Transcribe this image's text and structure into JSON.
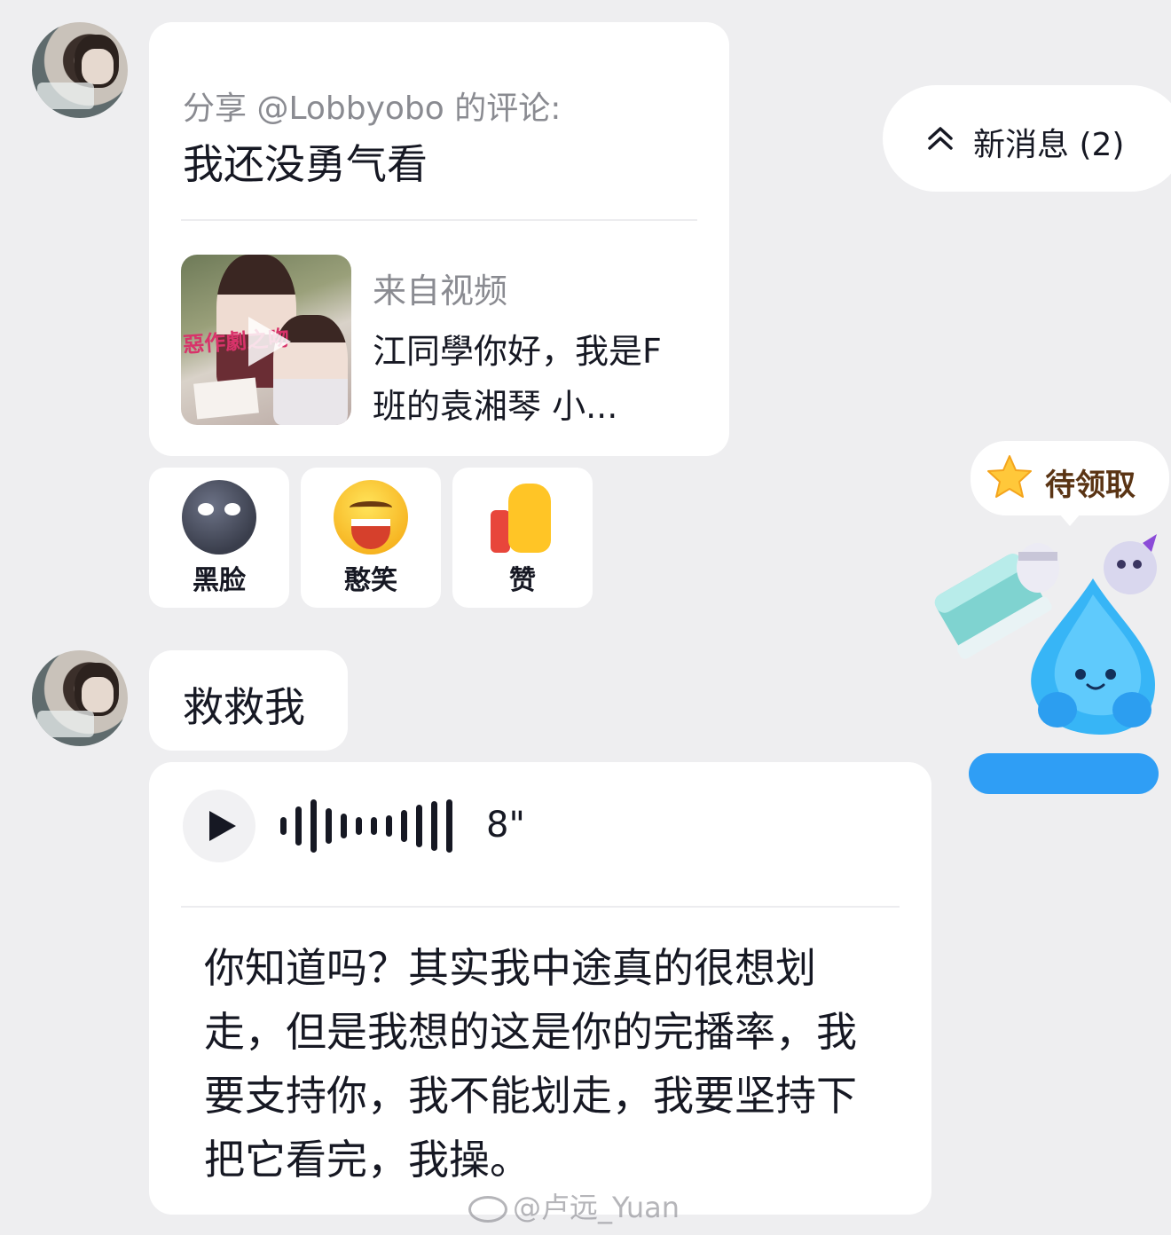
{
  "new_messages": {
    "label": "新消息 (2)"
  },
  "share_message": {
    "header": "分享 @Lobbyobo 的评论:",
    "comment": "我还没勇气看",
    "video": {
      "source_label": "来自视频",
      "title_art": "惡作劇之吻",
      "description": "江同學你好，我是F班的袁湘琴 小..."
    }
  },
  "reactions": [
    {
      "icon": "new-moon-face-emoji",
      "label": "黑脸"
    },
    {
      "icon": "grinning-face-emoji",
      "label": "憨笑"
    },
    {
      "icon": "thumbs-up-emoji",
      "label": "赞"
    }
  ],
  "text_message": {
    "text": "救救我"
  },
  "voice_message": {
    "duration": "8\"",
    "transcript": "你知道吗？其实我中途真的很想划走，但是我想的这是你的完播率，我要支持你，我不能划走，我要坚持下把它看完，我操。"
  },
  "reward_widget": {
    "label": "待领取",
    "icon": "star-icon"
  },
  "watermark": {
    "text": "@卢远_Yuan"
  },
  "colors": {
    "background": "#eeeef0",
    "bubble": "#ffffff",
    "text_primary": "#161823",
    "text_secondary": "#8a8b91",
    "reward_text": "#5a3414",
    "mascot_blue": "#2f9ef5"
  }
}
